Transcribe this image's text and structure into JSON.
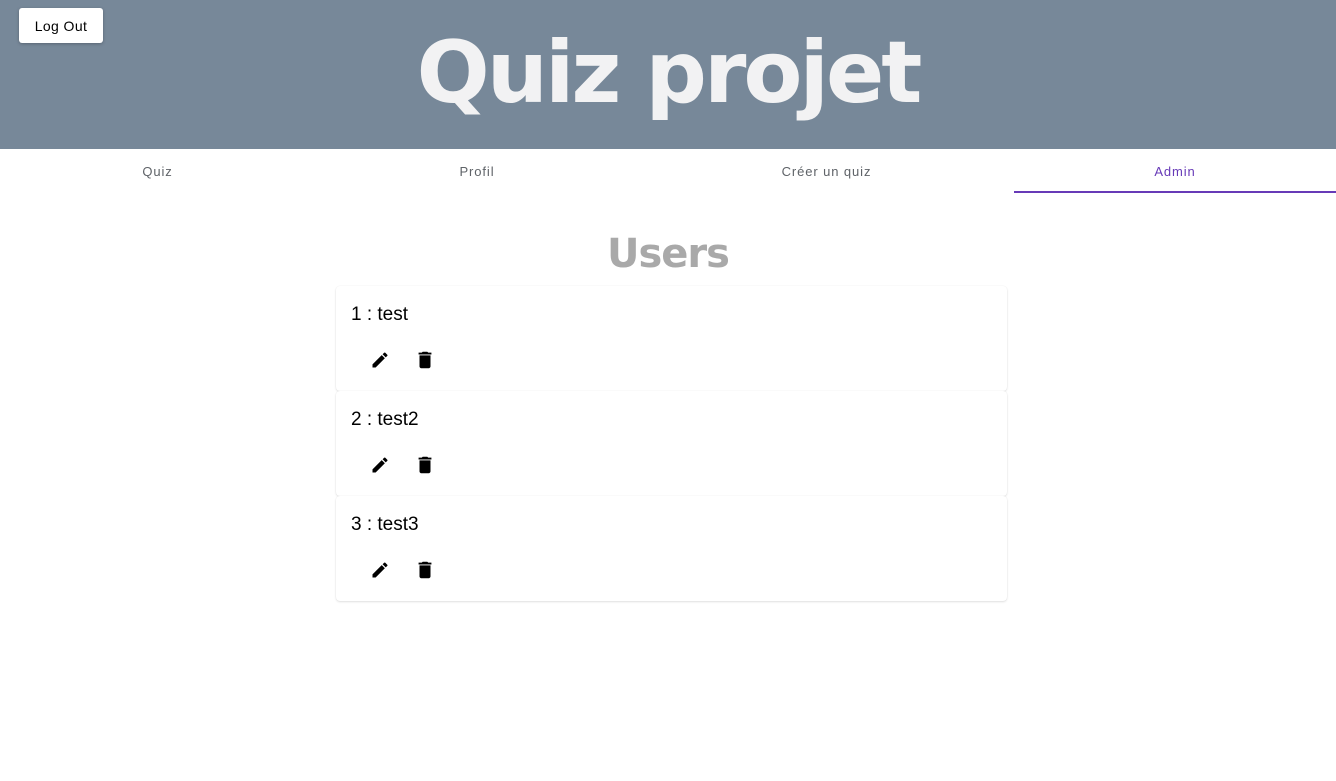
{
  "header": {
    "logout_label": "Log Out",
    "title": "Quiz projet",
    "background_color": "#778899"
  },
  "tabs": [
    {
      "label": "Quiz",
      "active": false
    },
    {
      "label": "Profil",
      "active": false
    },
    {
      "label": "Créer un quiz",
      "active": false
    },
    {
      "label": "Admin",
      "active": true
    }
  ],
  "accent_color": "#673ab7",
  "main": {
    "title": "Users",
    "users": [
      {
        "label": "1 : test",
        "actions": [
          "edit-icon",
          "delete-icon"
        ]
      },
      {
        "label": "2 : test2",
        "actions": [
          "edit-icon",
          "delete-icon"
        ]
      },
      {
        "label": "3 : test3",
        "actions": [
          "edit-icon",
          "delete-icon"
        ]
      }
    ]
  }
}
